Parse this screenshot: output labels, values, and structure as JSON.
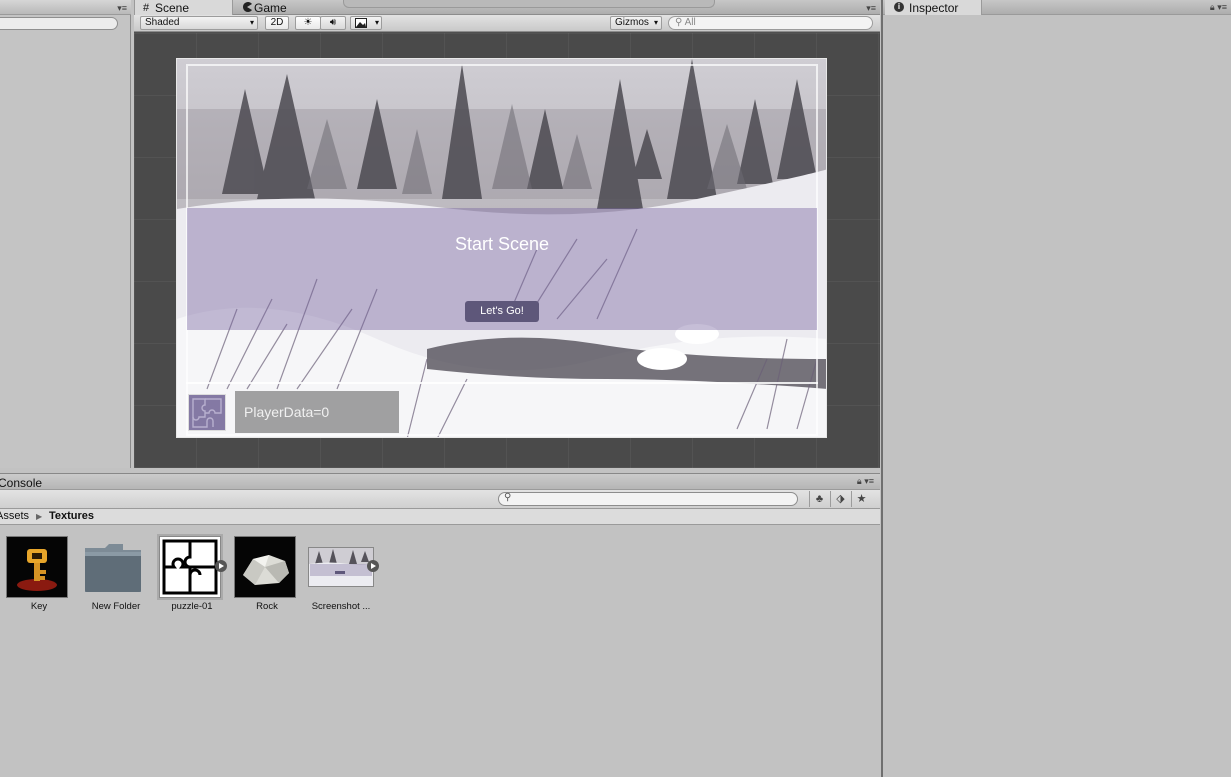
{
  "hierarchy": {
    "menu_icon": "▾≡"
  },
  "scene_window": {
    "tabs": [
      {
        "label": "Scene",
        "icon": "grid-icon"
      },
      {
        "label": "Game",
        "icon": "pacman-icon"
      }
    ],
    "toolbar": {
      "shading_mode": "Shaded",
      "mode_2d": "2D",
      "gizmos": "Gizmos",
      "search_placeholder": "All"
    },
    "menu_icon": "▾≡",
    "game_ui": {
      "title": "Start Scene",
      "button_label": "Let's Go!",
      "hud_text": "PlayerData=0"
    }
  },
  "inspector": {
    "tab_label": "Inspector",
    "info_glyph": "i",
    "corner_icons": "▾≡"
  },
  "console": {
    "tab_label": "Console",
    "corner_icons": "▾≡"
  },
  "project": {
    "breadcrumb": [
      "Assets",
      "Textures"
    ],
    "assets": [
      {
        "label": "Key",
        "icon": "key-icon"
      },
      {
        "label": "New Folder",
        "icon": "folder-icon"
      },
      {
        "label": "puzzle-01",
        "icon": "puzzle-icon",
        "expandable": true
      },
      {
        "label": "Rock",
        "icon": "rock-icon"
      },
      {
        "label": "Screenshot ...",
        "icon": "screenshot-icon",
        "expandable": true
      }
    ]
  }
}
